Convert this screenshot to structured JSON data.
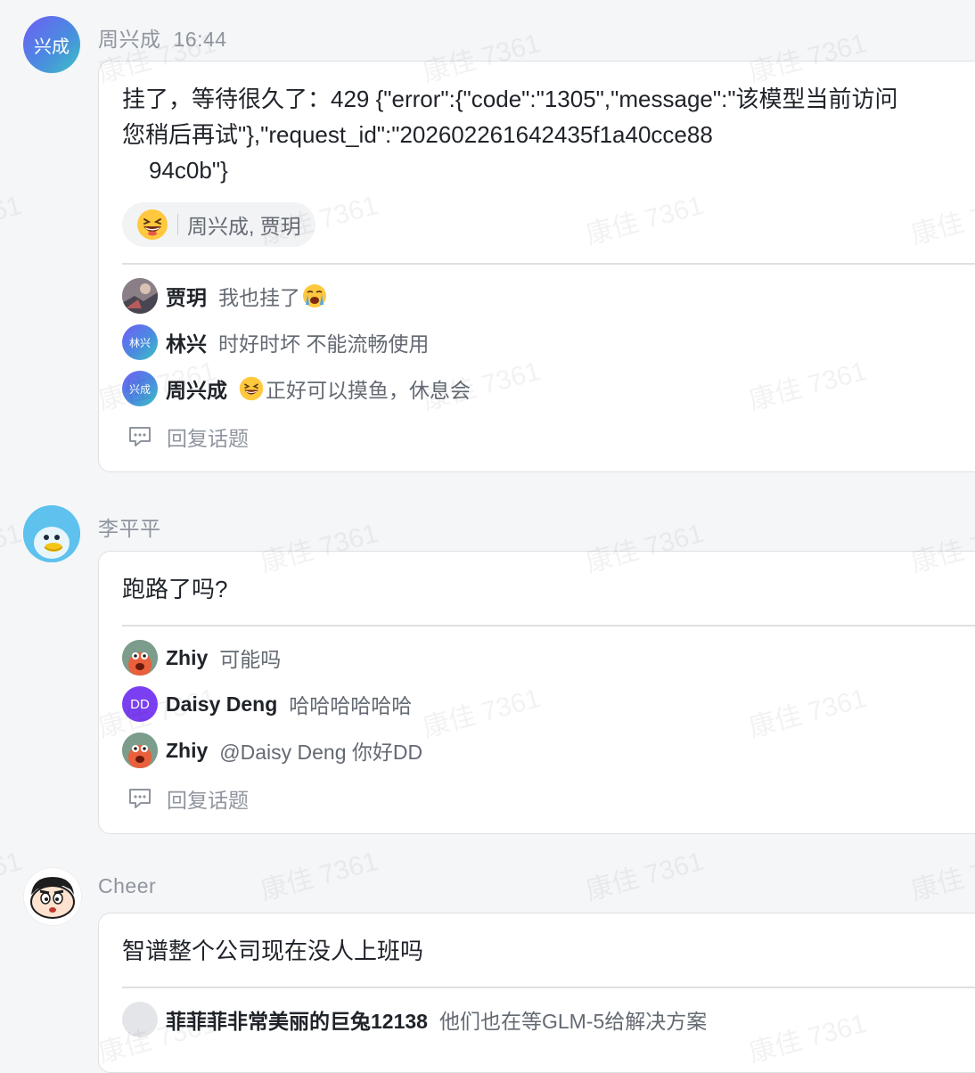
{
  "watermark": "康佳 7361",
  "messages": [
    {
      "sender": "周兴成",
      "time": "16:44",
      "avatar_text": "兴成",
      "body_lines": [
        "挂了，等待很久了：429 {\"error\":{\"code\":\"1305\",\"message\":\"该模型当前访问",
        "您稍后再试\"},\"request_id\":\"202602261642435f1a40cce88",
        "94c0b\"}"
      ],
      "reaction": {
        "icon": "laughing-emoji-icon",
        "users": "周兴成, 贾玥"
      },
      "replies": [
        {
          "name": "贾玥",
          "text": "我也挂了",
          "text_emoji": "crying-emoji-icon",
          "avatar": "photo"
        },
        {
          "name": "林兴",
          "text": "时好时坏 不能流畅使用",
          "avatar_text": "林兴"
        },
        {
          "name": "周兴成",
          "text": "正好可以摸鱼，休息会",
          "lead_emoji": "laughing-emoji-icon",
          "avatar_text": "兴成"
        }
      ],
      "reply_topic": "回复话题"
    },
    {
      "sender": "李平平",
      "avatar_icon": "duck-icon",
      "body_lines": [
        "跑路了吗?"
      ],
      "replies": [
        {
          "name": "Zhiy",
          "text": "可能吗",
          "avatar_icon": "cartoon-character-icon"
        },
        {
          "name": "Daisy Deng",
          "text": "哈哈哈哈哈哈",
          "avatar_text": "DD"
        },
        {
          "name": "Zhiy",
          "text": "@Daisy Deng 你好DD",
          "avatar_icon": "cartoon-character-icon"
        }
      ],
      "reply_topic": "回复话题"
    },
    {
      "sender": "Cheer",
      "avatar_icon": "crayon-shinchan-icon",
      "body_lines": [
        "智谱整个公司现在没人上班吗"
      ],
      "replies": [
        {
          "name": "菲菲菲非常美丽的巨兔12138",
          "text": "他们也在等GLM-5给解决方案",
          "avatar_icon": "placeholder-avatar-icon"
        }
      ]
    }
  ],
  "colors": {
    "accent_gradient_start": "#6f5ef5",
    "accent_gradient_end": "#3cc3c2",
    "daisy_avatar": "#7b3ff2",
    "muted_text": "#8f959e"
  }
}
